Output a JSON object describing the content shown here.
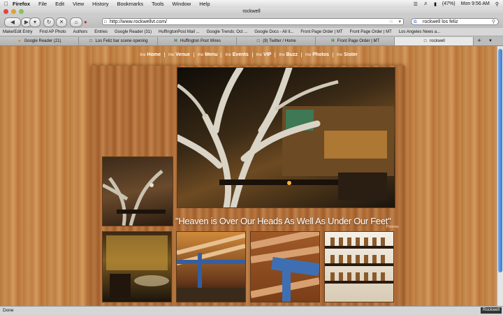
{
  "menubar": {
    "app": "Firefox",
    "items": [
      "File",
      "Edit",
      "View",
      "History",
      "Bookmarks",
      "Tools",
      "Window",
      "Help"
    ],
    "battery": "(47%)",
    "clock": "Mon 9:56 AM"
  },
  "window": {
    "title": "rockwell"
  },
  "toolbar": {
    "url": "http://www.rockwellvt.com/",
    "search_value": "rockwell los feliz"
  },
  "bookmarks": [
    "Make/Edit Entry",
    "Find AP Photo",
    "Authors",
    "Entries",
    "Google Reader (31)",
    "HuffingtonPost Mail ...",
    "Google Trends: Oct ...",
    "Google Docs - All it...",
    "Front Page Order | MT",
    "Front Page Order | MT",
    "Los Angeles News a..."
  ],
  "tabs": [
    {
      "label": "Google Reader (21)",
      "icon": "rss-icon"
    },
    {
      "label": "Los Feliz bar scene opening",
      "icon": "page-icon"
    },
    {
      "label": "Huffington Post Wires",
      "icon": "h-icon"
    },
    {
      "label": "(9) Twitter / Home",
      "icon": "page-icon"
    },
    {
      "label": "Front Page Order | MT",
      "icon": "h-icon"
    },
    {
      "label": "rockwell",
      "icon": "page-icon"
    }
  ],
  "site": {
    "nav": [
      {
        "prefix": "the",
        "label": "Home"
      },
      {
        "prefix": "the",
        "label": "Venue"
      },
      {
        "prefix": "the",
        "label": "Menu"
      },
      {
        "prefix": "the",
        "label": "Events"
      },
      {
        "prefix": "the",
        "label": "VIP"
      },
      {
        "prefix": "the",
        "label": "Buzz"
      },
      {
        "prefix": "the",
        "label": "Photos"
      },
      {
        "prefix": "the",
        "label": "Sister"
      }
    ],
    "quote": "\"Heaven is Over Our Heads As Well As Under Our Feet\"",
    "quote_source": "Thoreau"
  },
  "status": {
    "text": "Done",
    "badge": "Rockwell"
  },
  "colors": {
    "wood": "#c98c4d",
    "accent": "#3d77cf"
  }
}
